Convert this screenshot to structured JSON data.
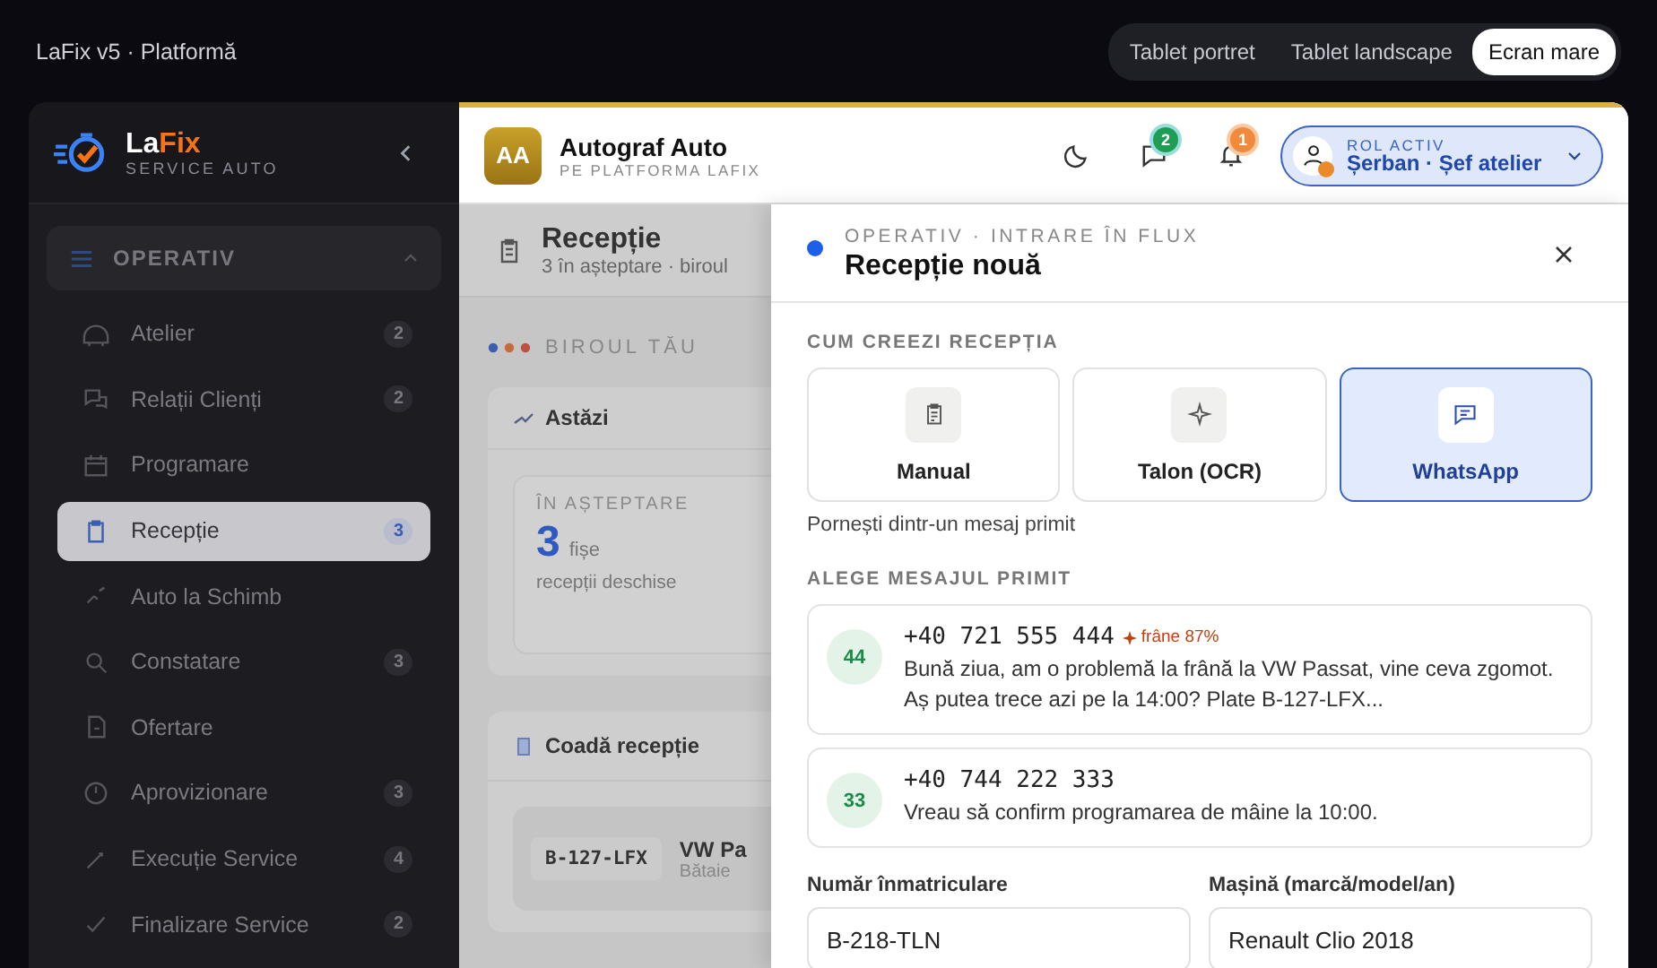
{
  "app_title": "LaFix v5 · Platformă",
  "view_modes": [
    {
      "label": "Tablet portret",
      "selected": false
    },
    {
      "label": "Tablet landscape",
      "selected": false
    },
    {
      "label": "Ecran mare",
      "selected": true
    }
  ],
  "brand": {
    "name_start": "La",
    "name_end": "Fix",
    "subtitle": "SERVICE AUTO"
  },
  "sidebar": {
    "group": {
      "label": "OPERATIV",
      "expanded": true
    },
    "items": [
      {
        "label": "Atelier",
        "count": "2",
        "selected": false
      },
      {
        "label": "Relații Clienți",
        "count": "2",
        "selected": false
      },
      {
        "label": "Programare",
        "selected": false
      },
      {
        "label": "Recepție",
        "count": "3",
        "selected": true
      },
      {
        "label": "Auto la Schimb",
        "selected": false
      },
      {
        "label": "Constatare",
        "count": "3",
        "selected": false
      },
      {
        "label": "Ofertare",
        "selected": false
      },
      {
        "label": "Aprovizionare",
        "count": "3",
        "selected": false
      },
      {
        "label": "Execuție Service",
        "count": "4",
        "selected": false
      },
      {
        "label": "Finalizare Service",
        "count": "2",
        "selected": false
      }
    ]
  },
  "header": {
    "workshop": {
      "initials": "AA",
      "name": "Autograf Auto",
      "subtitle": "PE PLATFORMA LAFIX"
    },
    "messages_badge": "2",
    "notifications_badge": "1",
    "role": {
      "label": "ROL ACTIV",
      "name": "Șerban · Șef atelier"
    }
  },
  "page": {
    "title": "Recepție",
    "subtitle": "3 în așteptare · biroul",
    "office_label": "BIROUL TĂU",
    "today": {
      "title": "Astăzi",
      "stat_label": "ÎN AȘTEPTARE",
      "stat_value": "3",
      "stat_unit": "fișe",
      "stat_note": "recepții deschise"
    },
    "queue": {
      "title": "Coadă recepție",
      "rows": [
        {
          "plate": "B-127-LFX",
          "car": "VW Pa",
          "note": "Bătaie"
        }
      ]
    }
  },
  "drawer": {
    "overline": "OPERATIV · INTRARE ÎN FLUX",
    "title": "Recepție nouă",
    "methods_label": "CUM CREEZI RECEPȚIA",
    "methods": [
      {
        "kind": "manual",
        "label": "Manual",
        "selected": false
      },
      {
        "kind": "ocr",
        "label": "Talon (OCR)",
        "selected": false
      },
      {
        "kind": "whatsapp",
        "label": "WhatsApp",
        "selected": true
      }
    ],
    "method_hint": "Pornești dintr-un mesaj primit",
    "messages_label": "ALEGE MESAJUL PRIMIT",
    "messages": [
      {
        "score": "44",
        "phone": "+40 721 555 444",
        "tag": "frâne 87%",
        "text": "Bună ziua, am o problemă la frână la VW Passat, vine ceva zgomot. Aș putea trece azi pe la 14:00? Plate B-127-LFX..."
      },
      {
        "score": "33",
        "phone": "+40 744 222 333",
        "text": "Vreau să confirm programarea de mâine la 10:00."
      }
    ],
    "fields": [
      {
        "label": "Număr înmatriculare",
        "value": "B-218-TLN"
      },
      {
        "label": "Mașină (marcă/model/an)",
        "value": "Renault Clio 2018"
      }
    ]
  }
}
